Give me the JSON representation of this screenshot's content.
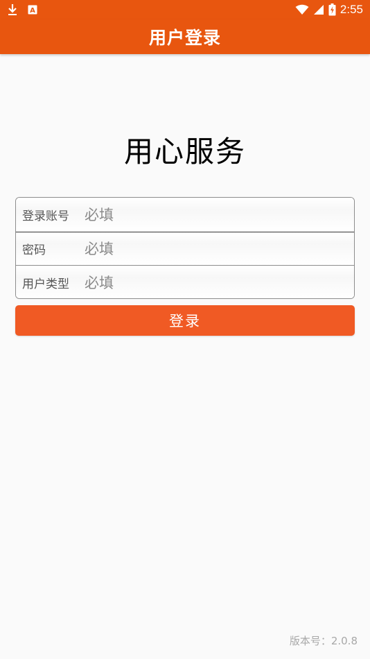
{
  "status_bar": {
    "time": "2:55",
    "icons": [
      "download-icon",
      "font-a-icon",
      "wifi-icon",
      "signal-icon",
      "battery-charging-icon"
    ],
    "notif_a_glyph": "A"
  },
  "app_bar": {
    "title": "用户登录"
  },
  "slogan": "用心服务",
  "form": {
    "fields": [
      {
        "label": "登录账号",
        "value": "",
        "placeholder": "必填"
      },
      {
        "label": "密码",
        "value": "",
        "placeholder": "必填"
      },
      {
        "label": "用户类型",
        "value": "",
        "placeholder": "必填"
      }
    ]
  },
  "login_button": {
    "label": "登录"
  },
  "version": "版本号：2.0.8",
  "colors": {
    "primary": "#e8560f",
    "button": "#f05a24",
    "background": "#fafafa",
    "version_text": "#a8a8a8"
  }
}
